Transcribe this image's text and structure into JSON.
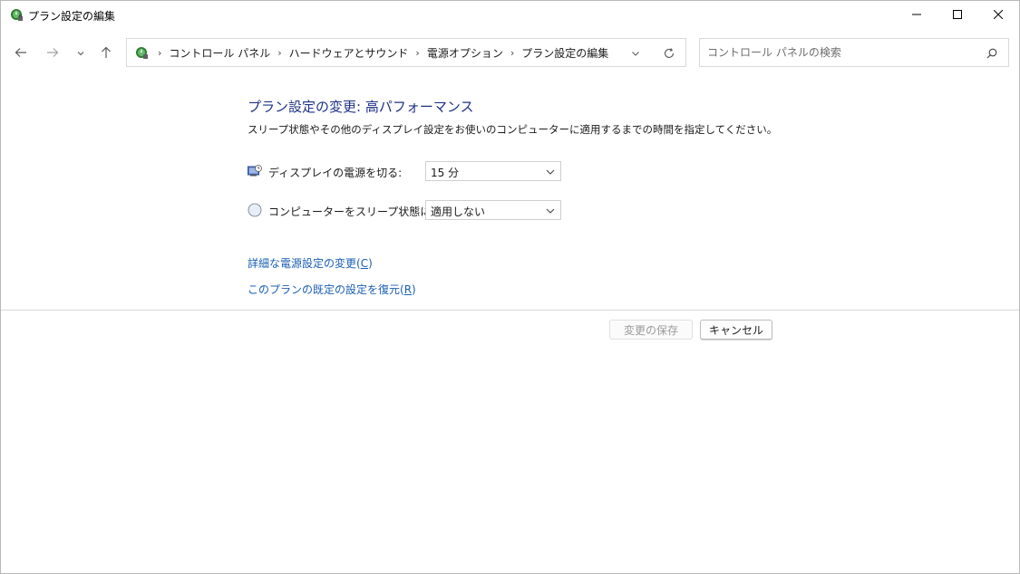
{
  "window": {
    "title": "プラン設定の編集"
  },
  "nav": {
    "breadcrumbs": [
      "コントロール パネル",
      "ハードウェアとサウンド",
      "電源オプション",
      "プラン設定の編集"
    ],
    "search_placeholder": "コントロール パネルの検索"
  },
  "content": {
    "heading": "プラン設定の変更: 高パフォーマンス",
    "description": "スリープ状態やその他のディスプレイ設定をお使いのコンピューターに適用するまでの時間を指定してください。",
    "display_off": {
      "label": "ディスプレイの電源を切る:",
      "value": "15 分"
    },
    "sleep": {
      "label": "コンピューターをスリープ状態にする:",
      "value": "適用しない"
    },
    "advanced_link": {
      "text": "詳細な電源設定の変更(",
      "key": "C",
      "tail": ")"
    },
    "restore_link": {
      "text": "このプランの既定の設定を復元(",
      "key": "R",
      "tail": ")"
    }
  },
  "buttons": {
    "save": "変更の保存",
    "cancel": "キャンセル"
  },
  "icons": {
    "app": "power-options-icon",
    "back": "arrow-left-icon",
    "forward": "arrow-right-icon",
    "recent": "chevron-down-icon",
    "up": "arrow-up-icon",
    "refresh": "refresh-icon",
    "search": "search-icon",
    "display": "monitor-clock-icon",
    "sleep": "moon-icon"
  },
  "colors": {
    "heading": "#1e3287",
    "link": "#1a5fb4",
    "disabled_text": "#9a9a9a"
  }
}
